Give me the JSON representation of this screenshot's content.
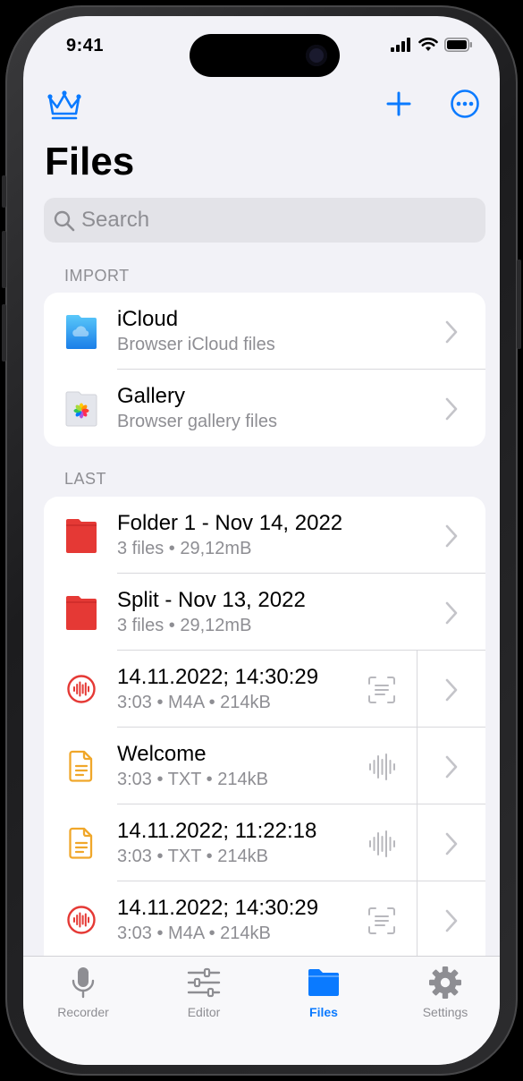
{
  "status_bar": {
    "time": "9:41"
  },
  "page": {
    "title": "Files"
  },
  "search": {
    "placeholder": "Search"
  },
  "import": {
    "header": "IMPORT",
    "items": [
      {
        "title": "iCloud",
        "subtitle": "Browser iCloud files",
        "icon": "icloud-folder-icon"
      },
      {
        "title": "Gallery",
        "subtitle": "Browser gallery files",
        "icon": "gallery-folder-icon"
      }
    ]
  },
  "last": {
    "header": "LAST",
    "items": [
      {
        "title": "Folder 1 - Nov 14, 2022",
        "subtitle": "3 files • 29,12mB",
        "icon": "red-folder-icon"
      },
      {
        "title": "Split - Nov 13, 2022",
        "subtitle": "3 files • 29,12mB",
        "icon": "red-folder-icon"
      },
      {
        "title": "14.11.2022; 14:30:29",
        "subtitle": "3:03 • M4A • 214kB",
        "icon": "audio-file-icon",
        "action": "transcribe-icon"
      },
      {
        "title": "Welcome",
        "subtitle": "3:03 • TXT • 214kB",
        "icon": "text-file-icon",
        "action": "waveform-icon"
      },
      {
        "title": "14.11.2022; 11:22:18",
        "subtitle": "3:03 • TXT • 214kB",
        "icon": "text-file-icon",
        "action": "waveform-icon"
      },
      {
        "title": "14.11.2022; 14:30:29",
        "subtitle": "3:03 • M4A • 214kB",
        "icon": "audio-file-icon",
        "action": "transcribe-icon"
      }
    ]
  },
  "tabs": [
    {
      "label": "Recorder",
      "icon": "microphone-icon",
      "active": false
    },
    {
      "label": "Editor",
      "icon": "sliders-icon",
      "active": false
    },
    {
      "label": "Files",
      "icon": "folder-icon",
      "active": true
    },
    {
      "label": "Settings",
      "icon": "gear-icon",
      "active": false
    }
  ],
  "colors": {
    "accent": "#0a7aff",
    "background": "#f2f2f7",
    "folder_red": "#e53935",
    "file_orange": "#f0a72a",
    "secondary_text": "#8e8e93"
  }
}
